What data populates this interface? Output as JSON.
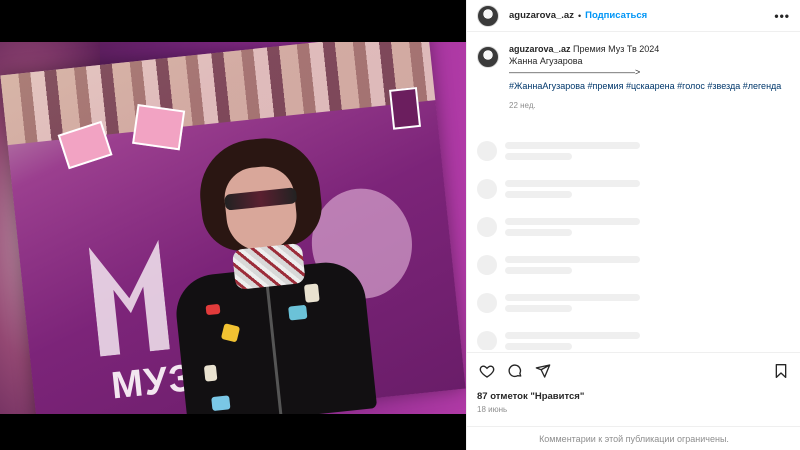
{
  "post": {
    "username": "aguzarova_.az",
    "follow_label": "Подписаться",
    "separator": "•",
    "more_label": "•••"
  },
  "caption": {
    "username": "aguzarova_.az",
    "line1": "Премия Муз Тв 2024",
    "line2": "Жанна Агузарова",
    "line3": "——————————————>",
    "hashtags": "#ЖаннаАгузарова #премия #цскаарена #голос #звезда #легенда",
    "time": "22 нед."
  },
  "media": {
    "logo_text": "МУЗ"
  },
  "actions": {
    "likes_text": "87 отметок \"Нравится\"",
    "date_text": "18 июнь"
  },
  "footer": {
    "comments_limited": "Комментарии к этой публикации ограничены."
  },
  "icons": {
    "like": "heart-icon",
    "comment": "comment-icon",
    "share": "share-icon",
    "save": "bookmark-icon"
  },
  "colors": {
    "accent": "#0095f6",
    "hashtag": "#00376b",
    "muted": "#8e8e8e"
  }
}
